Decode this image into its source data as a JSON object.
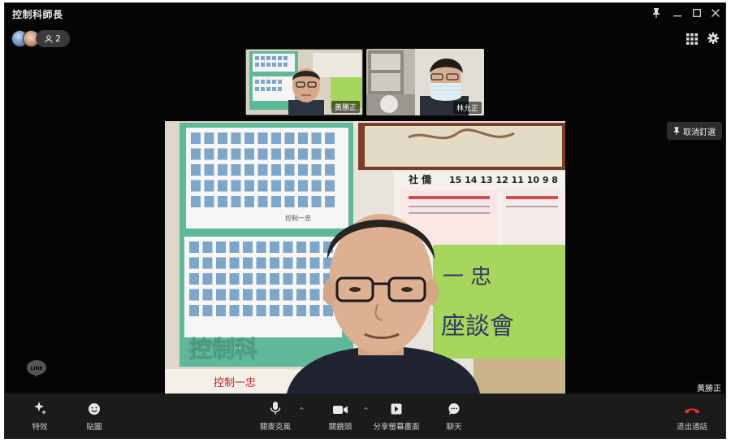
{
  "window": {
    "title": "控制科師長"
  },
  "participants": {
    "count": "2"
  },
  "thumbnails": [
    {
      "name": "黃勝正"
    },
    {
      "name": "林允正"
    }
  ],
  "main_video": {
    "name": "黃勝正",
    "sign_texts": [
      "控制科",
      "控制一忠",
      "一 忠",
      "座談會",
      "社 僑",
      "15 14 13 12 11 10 9 8"
    ]
  },
  "unpin": {
    "label": "取消釘選"
  },
  "toolbar": {
    "effects": "特效",
    "sticker": "貼圖",
    "mic": "關麥克風",
    "camera": "關鏡頭",
    "share": "分享螢幕畫面",
    "chat": "聊天",
    "leave": "退出通話"
  },
  "colors": {
    "window_bg": "#050505",
    "toolbar_bg": "#1b1b1b",
    "leave_red": "#e0302a",
    "poster_green": "#9fd35c",
    "board_teal": "#5fb89a"
  },
  "icons": [
    "pin-icon",
    "minimize-icon",
    "maximize-icon",
    "close-icon",
    "user-icon",
    "grid-icon",
    "gear-icon",
    "sparkle-icon",
    "smiley-icon",
    "microphone-icon",
    "camera-icon",
    "share-screen-icon",
    "chat-bubble-icon",
    "hang-up-icon",
    "line-logo-icon"
  ]
}
